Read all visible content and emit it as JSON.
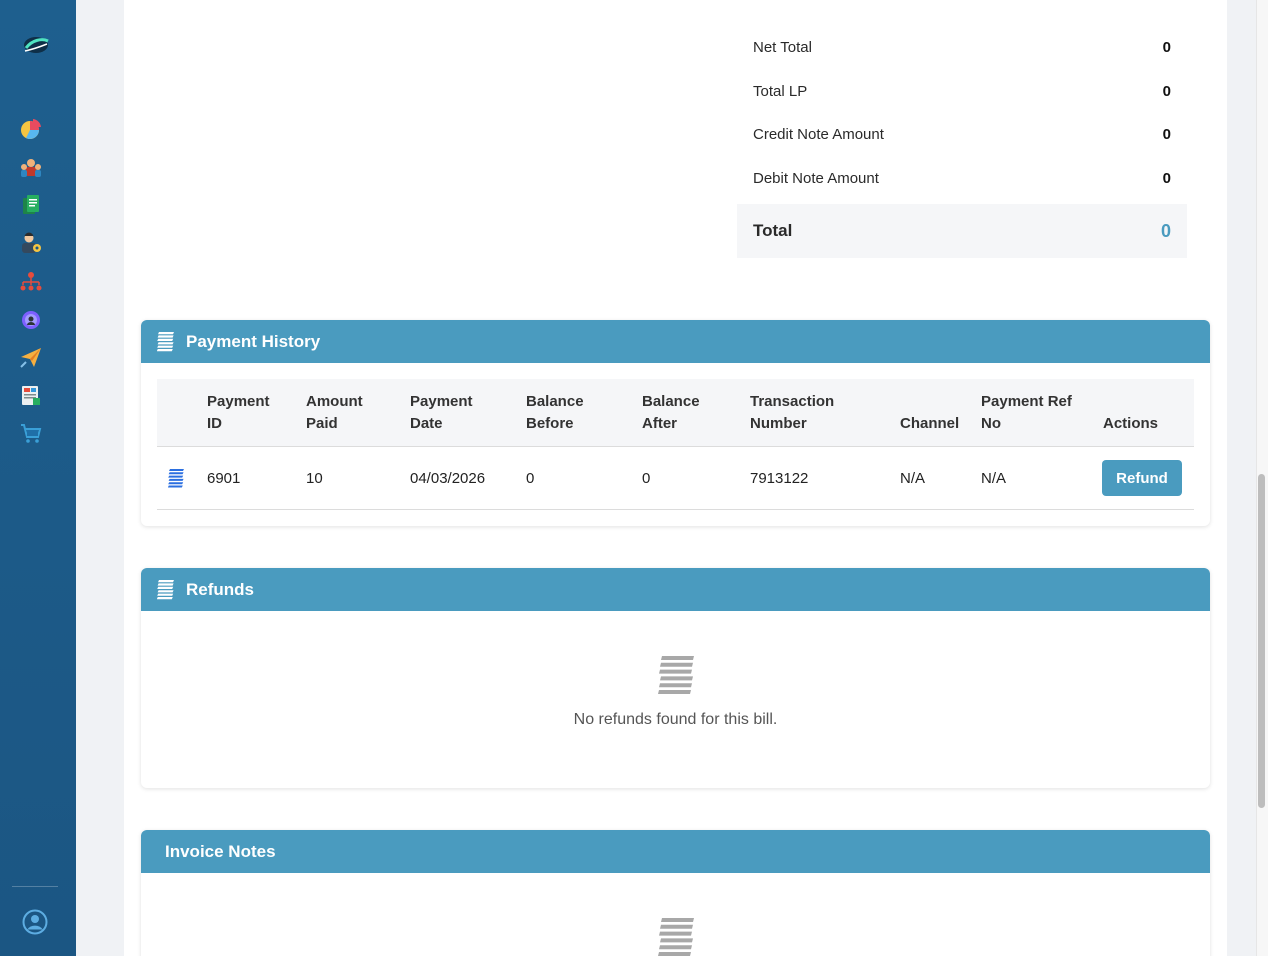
{
  "totals": {
    "rows": [
      {
        "label": "Net Total",
        "value": "0"
      },
      {
        "label": "Total LP",
        "value": "0"
      },
      {
        "label": "Credit Note Amount",
        "value": "0"
      },
      {
        "label": "Debit Note Amount",
        "value": "0"
      }
    ],
    "total_label": "Total",
    "total_value": "0"
  },
  "payment_history": {
    "title": "Payment History",
    "columns": {
      "payment_id": [
        "Payment",
        "ID"
      ],
      "amount_paid": [
        "Amount",
        "Paid"
      ],
      "payment_date": [
        "Payment",
        "Date"
      ],
      "balance_before": [
        "Balance",
        "Before"
      ],
      "balance_after": [
        "Balance",
        "After"
      ],
      "transaction_number": [
        "Transaction",
        "Number"
      ],
      "channel": "Channel",
      "payment_ref_no": [
        "Payment Ref",
        "No"
      ],
      "actions": "Actions"
    },
    "rows": [
      {
        "payment_id": "6901",
        "amount_paid": "10",
        "payment_date": "04/03/2026",
        "balance_before": "0",
        "balance_after": "0",
        "transaction_number": "7913122",
        "channel": "N/A",
        "payment_ref_no": "N/A",
        "action_label": "Refund"
      }
    ]
  },
  "refunds": {
    "title": "Refunds",
    "empty_text": "No refunds found for this bill."
  },
  "invoice_notes": {
    "title": "Invoice Notes"
  },
  "sidebar": {
    "icons": [
      "logo-icon",
      "dashboard-chart-icon",
      "customers-group-icon",
      "documents-icon",
      "users-admin-icon",
      "hierarchy-icon",
      "settings-gear-icon",
      "send-paper-plane-icon",
      "reports-icon",
      "shopping-cart-icon",
      "user-profile-icon"
    ]
  },
  "colors": {
    "sidebar": "#1e5f8e",
    "accent": "#4a9bbf",
    "panel_bg": "#ffffff",
    "page_bg": "#f0f2f5"
  }
}
